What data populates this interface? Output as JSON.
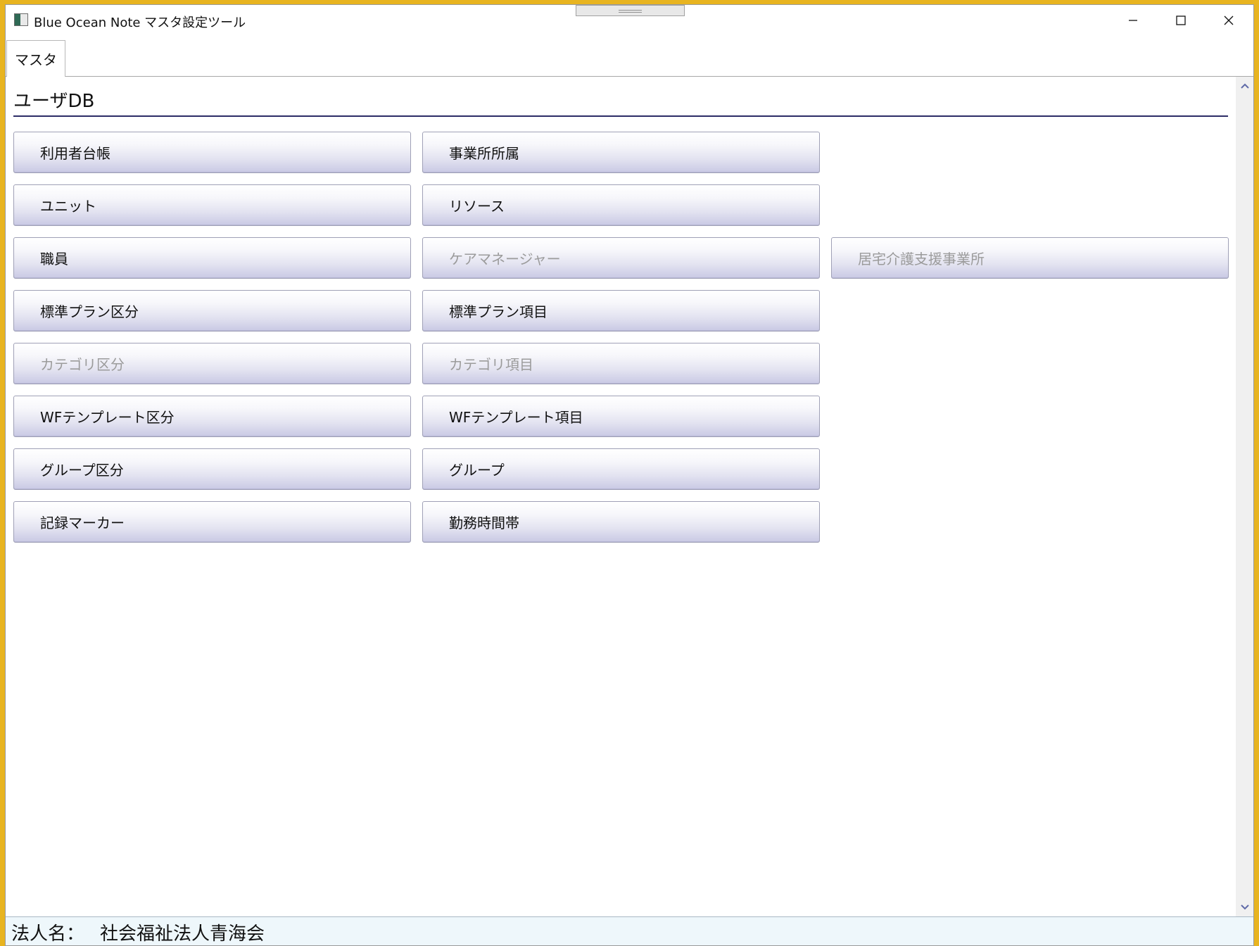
{
  "window": {
    "title": "Blue Ocean Note マスタ設定ツール"
  },
  "tabs": [
    {
      "label": "マスタ",
      "selected": true
    }
  ],
  "section": {
    "title": "ユーザDB"
  },
  "buttons": {
    "riyousha_daichou": {
      "label": "利用者台帳",
      "enabled": true
    },
    "jigyousho_shozoku": {
      "label": "事業所所属",
      "enabled": true
    },
    "unit": {
      "label": "ユニット",
      "enabled": true
    },
    "resource": {
      "label": "リソース",
      "enabled": true
    },
    "shokuin": {
      "label": "職員",
      "enabled": true
    },
    "care_manager": {
      "label": "ケアマネージャー",
      "enabled": false
    },
    "kyotaku_kaigo": {
      "label": "居宅介護支援事業所",
      "enabled": false
    },
    "hyoujun_plan_kubun": {
      "label": "標準プラン区分",
      "enabled": true
    },
    "hyoujun_plan_koumoku": {
      "label": "標準プラン項目",
      "enabled": true
    },
    "category_kubun": {
      "label": "カテゴリ区分",
      "enabled": false
    },
    "category_koumoku": {
      "label": "カテゴリ項目",
      "enabled": false
    },
    "wf_template_kubun": {
      "label": "WFテンプレート区分",
      "enabled": true
    },
    "wf_template_koumoku": {
      "label": "WFテンプレート項目",
      "enabled": true
    },
    "group_kubun": {
      "label": "グループ区分",
      "enabled": true
    },
    "group": {
      "label": "グループ",
      "enabled": true
    },
    "kiroku_marker": {
      "label": "記録マーカー",
      "enabled": true
    },
    "kinmu_jikantai": {
      "label": "勤務時間帯",
      "enabled": true
    }
  },
  "status": {
    "label": "法人名：",
    "value": "社会福祉法人青海会"
  },
  "colors": {
    "accent_rule": "#2c2c66",
    "disabled_text": "#9b9b9b",
    "status_bg": "#eef7fb",
    "desktop_border": "#e8b420"
  },
  "icons": {
    "app": "app-icon",
    "minimize": "minimize-icon",
    "maximize": "maximize-icon",
    "close": "close-icon",
    "scroll_up": "chevron-up-icon",
    "scroll_down": "chevron-down-icon"
  }
}
